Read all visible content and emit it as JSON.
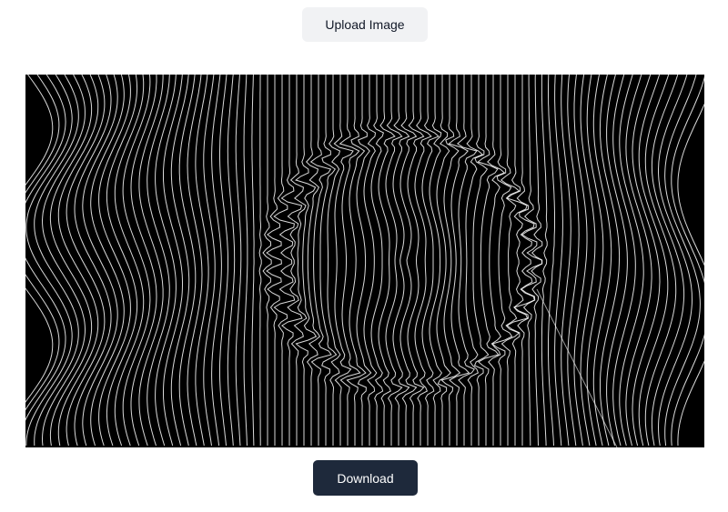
{
  "upload": {
    "label": "Upload Image"
  },
  "preview": {
    "background": "#000000",
    "line_color": "#ffffff"
  },
  "download": {
    "label": "Download"
  },
  "colors": {
    "upload_bg": "#f1f2f4",
    "download_bg": "#1e293b"
  }
}
